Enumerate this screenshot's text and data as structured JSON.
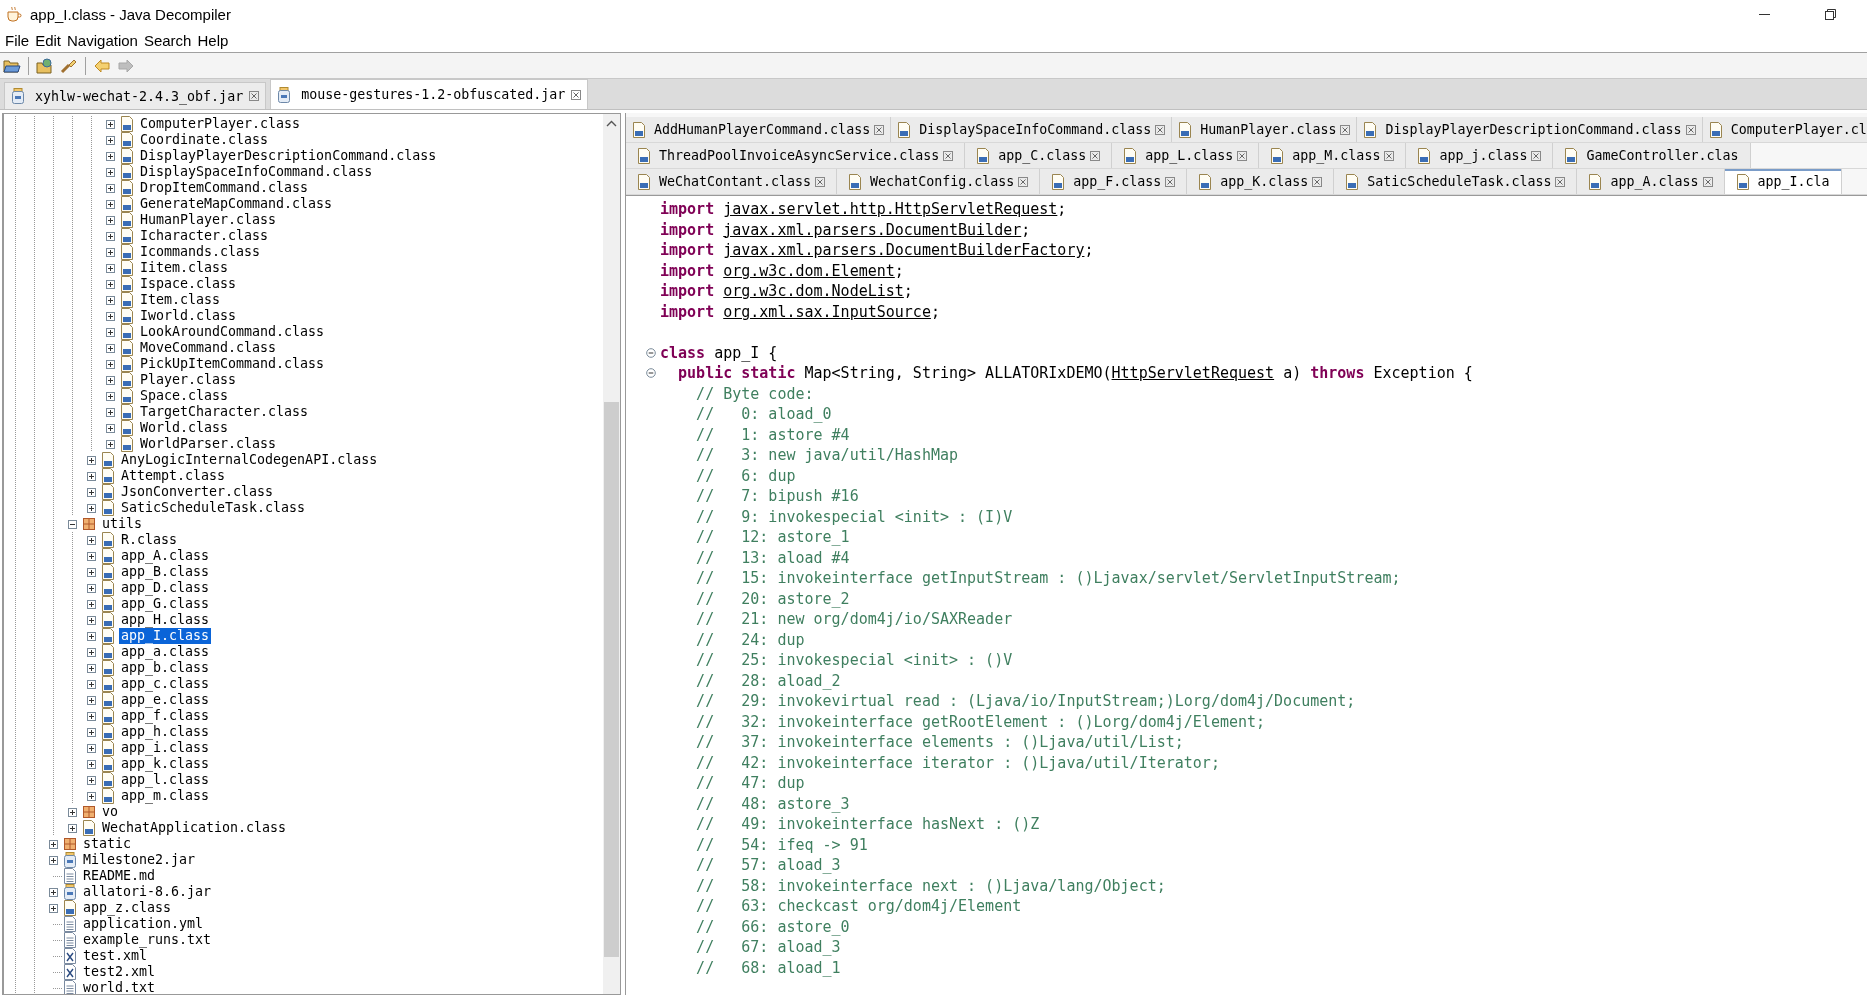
{
  "window": {
    "title": "app_I.class - Java Decompiler"
  },
  "menu": [
    "File",
    "Edit",
    "Navigation",
    "Search",
    "Help"
  ],
  "toolbar": [
    {
      "kind": "open-file",
      "disabled": false
    },
    {
      "kind": "open-type",
      "disabled": false
    },
    {
      "kind": "search",
      "disabled": false
    },
    {
      "kind": "back",
      "disabled": false
    },
    {
      "kind": "forward",
      "disabled": true
    }
  ],
  "file_tabs": [
    {
      "label": "xyhlw-wechat-2.4.3_obf.jar",
      "selected": false
    },
    {
      "label": "mouse-gestures-1.2-obfuscated.jar",
      "selected": true
    }
  ],
  "tree": {
    "items": [
      {
        "children": [
          {
            "children": [
              {
                "children": [
                  {
                    "children": [
                      {
                        "children": [
                          {
                            "label": "ComputerPlayer.class",
                            "kind": "class",
                            "expanded": false,
                            "selected": false
                          },
                          {
                            "label": "Coordinate.class",
                            "kind": "class",
                            "expanded": false,
                            "selected": false
                          },
                          {
                            "label": "DisplayPlayerDescriptionCommand.class",
                            "kind": "class",
                            "expanded": false,
                            "selected": false
                          },
                          {
                            "label": "DisplaySpaceInfoCommand.class",
                            "kind": "class",
                            "expanded": false,
                            "selected": false
                          },
                          {
                            "label": "DropItemCommand.class",
                            "kind": "class",
                            "expanded": false,
                            "selected": false
                          },
                          {
                            "label": "GenerateMapCommand.class",
                            "kind": "class",
                            "expanded": false,
                            "selected": false
                          },
                          {
                            "label": "HumanPlayer.class",
                            "kind": "class",
                            "expanded": false,
                            "selected": false
                          },
                          {
                            "label": "Icharacter.class",
                            "kind": "class",
                            "expanded": false,
                            "selected": false
                          },
                          {
                            "label": "Icommands.class",
                            "kind": "class",
                            "expanded": false,
                            "selected": false
                          },
                          {
                            "label": "Iitem.class",
                            "kind": "class",
                            "expanded": false,
                            "selected": false
                          },
                          {
                            "label": "Ispace.class",
                            "kind": "class",
                            "expanded": false,
                            "selected": false
                          },
                          {
                            "label": "Item.class",
                            "kind": "class",
                            "expanded": false,
                            "selected": false
                          },
                          {
                            "label": "Iworld.class",
                            "kind": "class",
                            "expanded": false,
                            "selected": false
                          },
                          {
                            "label": "LookAroundCommand.class",
                            "kind": "class",
                            "expanded": false,
                            "selected": false
                          },
                          {
                            "label": "MoveCommand.class",
                            "kind": "class",
                            "expanded": false,
                            "selected": false
                          },
                          {
                            "label": "PickUpItemCommand.class",
                            "kind": "class",
                            "expanded": false,
                            "selected": false
                          },
                          {
                            "label": "Player.class",
                            "kind": "class",
                            "expanded": false,
                            "selected": false
                          },
                          {
                            "label": "Space.class",
                            "kind": "class",
                            "expanded": false,
                            "selected": false
                          },
                          {
                            "label": "TargetCharacter.class",
                            "kind": "class",
                            "expanded": false,
                            "selected": false
                          },
                          {
                            "label": "World.class",
                            "kind": "class",
                            "expanded": false,
                            "selected": false
                          },
                          {
                            "label": "WorldParser.class",
                            "kind": "class",
                            "expanded": false,
                            "selected": false
                          }
                        ]
                      },
                      {
                        "label": "AnyLogicInternalCodegenAPI.class",
                        "kind": "class",
                        "expanded": false,
                        "selected": false
                      },
                      {
                        "label": "Attempt.class",
                        "kind": "class",
                        "expanded": false,
                        "selected": false
                      },
                      {
                        "label": "JsonConverter.class",
                        "kind": "class",
                        "expanded": false,
                        "selected": false
                      },
                      {
                        "label": "SaticScheduleTask.class",
                        "kind": "class",
                        "expanded": false,
                        "selected": false
                      }
                    ]
                  },
                  {
                    "label": "utils",
                    "kind": "package",
                    "expanded": true,
                    "selected": false,
                    "children": [
                      {
                        "label": "R.class",
                        "kind": "class",
                        "expanded": false,
                        "selected": false
                      },
                      {
                        "label": "app_A.class",
                        "kind": "class",
                        "expanded": false,
                        "selected": false
                      },
                      {
                        "label": "app_B.class",
                        "kind": "class",
                        "expanded": false,
                        "selected": false
                      },
                      {
                        "label": "app_D.class",
                        "kind": "class",
                        "expanded": false,
                        "selected": false
                      },
                      {
                        "label": "app_G.class",
                        "kind": "class",
                        "expanded": false,
                        "selected": false
                      },
                      {
                        "label": "app_H.class",
                        "kind": "class",
                        "expanded": false,
                        "selected": false
                      },
                      {
                        "label": "app_I.class",
                        "kind": "class",
                        "expanded": false,
                        "selected": true
                      },
                      {
                        "label": "app_a.class",
                        "kind": "class",
                        "expanded": false,
                        "selected": false
                      },
                      {
                        "label": "app_b.class",
                        "kind": "class",
                        "expanded": false,
                        "selected": false
                      },
                      {
                        "label": "app_c.class",
                        "kind": "class",
                        "expanded": false,
                        "selected": false
                      },
                      {
                        "label": "app_e.class",
                        "kind": "class",
                        "expanded": false,
                        "selected": false
                      },
                      {
                        "label": "app_f.class",
                        "kind": "class",
                        "expanded": false,
                        "selected": false
                      },
                      {
                        "label": "app_h.class",
                        "kind": "class",
                        "expanded": false,
                        "selected": false
                      },
                      {
                        "label": "app_i.class",
                        "kind": "class",
                        "expanded": false,
                        "selected": false
                      },
                      {
                        "label": "app_k.class",
                        "kind": "class",
                        "expanded": false,
                        "selected": false
                      },
                      {
                        "label": "app_l.class",
                        "kind": "class",
                        "expanded": false,
                        "selected": false
                      },
                      {
                        "label": "app_m.class",
                        "kind": "class",
                        "expanded": false,
                        "selected": false
                      }
                    ]
                  },
                  {
                    "label": "vo",
                    "kind": "package",
                    "expanded": false,
                    "selected": false
                  },
                  {
                    "label": "WechatApplication.class",
                    "kind": "class",
                    "expanded": false,
                    "selected": false
                  }
                ]
              },
              {
                "label": "static",
                "kind": "package",
                "expanded": false,
                "selected": false
              },
              {
                "label": "Milestone2.jar",
                "kind": "jar",
                "expanded": false,
                "selected": false
              },
              {
                "label": "README.md",
                "kind": "text",
                "selected": false
              },
              {
                "label": "allatori-8.6.jar",
                "kind": "jar",
                "expanded": false,
                "selected": false
              },
              {
                "label": "app_z.class",
                "kind": "class",
                "expanded": false,
                "selected": false
              },
              {
                "label": "application.yml",
                "kind": "text",
                "selected": false
              },
              {
                "label": "example_runs.txt",
                "kind": "text",
                "selected": false
              },
              {
                "label": "test.xml",
                "kind": "xml",
                "selected": false
              },
              {
                "label": "test2.xml",
                "kind": "xml",
                "selected": false
              },
              {
                "label": "world.txt",
                "kind": "text",
                "selected": false
              }
            ]
          }
        ]
      }
    ]
  },
  "editor_tab_rows": [
    {
      "tabs": [
        {
          "label": "AddHumanPlayerCommand.class",
          "selected": false
        },
        {
          "label": "DisplaySpaceInfoCommand.class",
          "selected": false
        },
        {
          "label": "HumanPlayer.class",
          "selected": false
        },
        {
          "label": "DisplayPlayerDescriptionCommand.class",
          "selected": false
        },
        {
          "label": "ComputerPlayer.cl",
          "selected": false
        }
      ]
    },
    {
      "tabs": [
        {
          "label": "ThreadPoolInvoiceAsyncService.class",
          "selected": false
        },
        {
          "label": "app_C.class",
          "selected": false
        },
        {
          "label": "app_L.class",
          "selected": false
        },
        {
          "label": "app_M.class",
          "selected": false
        },
        {
          "label": "app_j.class",
          "selected": false
        },
        {
          "label": "GameController.clas",
          "selected": false
        }
      ]
    },
    {
      "tabs": [
        {
          "label": "WeChatContant.class",
          "selected": false
        },
        {
          "label": "WechatConfig.class",
          "selected": false
        },
        {
          "label": "app_F.class",
          "selected": false
        },
        {
          "label": "app_K.class",
          "selected": false
        },
        {
          "label": "SaticScheduleTask.class",
          "selected": false
        },
        {
          "label": "app_A.class",
          "selected": false
        },
        {
          "label": "app_I.cla",
          "selected": true
        }
      ]
    }
  ],
  "code": {
    "lines": [
      {
        "collapsible": false,
        "segments": [
          {
            "kind": "keyword",
            "text": "import "
          },
          {
            "kind": "link",
            "text": "javax.servlet.http.HttpServletRequest"
          },
          {
            "kind": "plain",
            "text": ";"
          }
        ]
      },
      {
        "collapsible": false,
        "segments": [
          {
            "kind": "keyword",
            "text": "import "
          },
          {
            "kind": "link",
            "text": "javax.xml.parsers.DocumentBuilder"
          },
          {
            "kind": "plain",
            "text": ";"
          }
        ]
      },
      {
        "collapsible": false,
        "segments": [
          {
            "kind": "keyword",
            "text": "import "
          },
          {
            "kind": "link",
            "text": "javax.xml.parsers.DocumentBuilderFactory"
          },
          {
            "kind": "plain",
            "text": ";"
          }
        ]
      },
      {
        "collapsible": false,
        "segments": [
          {
            "kind": "keyword",
            "text": "import "
          },
          {
            "kind": "link",
            "text": "org.w3c.dom.Element"
          },
          {
            "kind": "plain",
            "text": ";"
          }
        ]
      },
      {
        "collapsible": false,
        "segments": [
          {
            "kind": "keyword",
            "text": "import "
          },
          {
            "kind": "link",
            "text": "org.w3c.dom.NodeList"
          },
          {
            "kind": "plain",
            "text": ";"
          }
        ]
      },
      {
        "collapsible": false,
        "segments": [
          {
            "kind": "keyword",
            "text": "import "
          },
          {
            "kind": "link",
            "text": "org.xml.sax.InputSource"
          },
          {
            "kind": "plain",
            "text": ";"
          }
        ]
      },
      {
        "collapsible": false
      },
      {
        "collapsible": true,
        "segments": [
          {
            "kind": "keyword",
            "text": "class "
          },
          {
            "kind": "plain",
            "text": "app_I {"
          }
        ]
      },
      {
        "collapsible": true,
        "segments": [
          {
            "kind": "keyword",
            "text": "  public static "
          },
          {
            "kind": "plain",
            "text": "Map<String, String> ALLATORIxDEMO("
          },
          {
            "kind": "link",
            "text": "HttpServletRequest"
          },
          {
            "kind": "plain",
            "text": " a) "
          },
          {
            "kind": "keyword",
            "text": "throws "
          },
          {
            "kind": "plain",
            "text": "Exception {"
          }
        ]
      },
      {
        "collapsible": false,
        "segments": [
          {
            "kind": "comment",
            "text": "    // Byte code:"
          }
        ]
      },
      {
        "collapsible": false,
        "segments": [
          {
            "kind": "comment",
            "text": "    //   0: aload_0"
          }
        ]
      },
      {
        "collapsible": false,
        "segments": [
          {
            "kind": "comment",
            "text": "    //   1: astore #4"
          }
        ]
      },
      {
        "collapsible": false,
        "segments": [
          {
            "kind": "comment",
            "text": "    //   3: new java/util/HashMap"
          }
        ]
      },
      {
        "collapsible": false,
        "segments": [
          {
            "kind": "comment",
            "text": "    //   6: dup"
          }
        ]
      },
      {
        "collapsible": false,
        "segments": [
          {
            "kind": "comment",
            "text": "    //   7: bipush #16"
          }
        ]
      },
      {
        "collapsible": false,
        "segments": [
          {
            "kind": "comment",
            "text": "    //   9: invokespecial <init> : (I)V"
          }
        ]
      },
      {
        "collapsible": false,
        "segments": [
          {
            "kind": "comment",
            "text": "    //   12: astore_1"
          }
        ]
      },
      {
        "collapsible": false,
        "segments": [
          {
            "kind": "comment",
            "text": "    //   13: aload #4"
          }
        ]
      },
      {
        "collapsible": false,
        "segments": [
          {
            "kind": "comment",
            "text": "    //   15: invokeinterface getInputStream : ()Ljavax/servlet/ServletInputStream;"
          }
        ]
      },
      {
        "collapsible": false,
        "segments": [
          {
            "kind": "comment",
            "text": "    //   20: astore_2"
          }
        ]
      },
      {
        "collapsible": false,
        "segments": [
          {
            "kind": "comment",
            "text": "    //   21: new org/dom4j/io/SAXReader"
          }
        ]
      },
      {
        "collapsible": false,
        "segments": [
          {
            "kind": "comment",
            "text": "    //   24: dup"
          }
        ]
      },
      {
        "collapsible": false,
        "segments": [
          {
            "kind": "comment",
            "text": "    //   25: invokespecial <init> : ()V"
          }
        ]
      },
      {
        "collapsible": false,
        "segments": [
          {
            "kind": "comment",
            "text": "    //   28: aload_2"
          }
        ]
      },
      {
        "collapsible": false,
        "segments": [
          {
            "kind": "comment",
            "text": "    //   29: invokevirtual read : (Ljava/io/InputStream;)Lorg/dom4j/Document;"
          }
        ]
      },
      {
        "collapsible": false,
        "segments": [
          {
            "kind": "comment",
            "text": "    //   32: invokeinterface getRootElement : ()Lorg/dom4j/Element;"
          }
        ]
      },
      {
        "collapsible": false,
        "segments": [
          {
            "kind": "comment",
            "text": "    //   37: invokeinterface elements : ()Ljava/util/List;"
          }
        ]
      },
      {
        "collapsible": false,
        "segments": [
          {
            "kind": "comment",
            "text": "    //   42: invokeinterface iterator : ()Ljava/util/Iterator;"
          }
        ]
      },
      {
        "collapsible": false,
        "segments": [
          {
            "kind": "comment",
            "text": "    //   47: dup"
          }
        ]
      },
      {
        "collapsible": false,
        "segments": [
          {
            "kind": "comment",
            "text": "    //   48: astore_3"
          }
        ]
      },
      {
        "collapsible": false,
        "segments": [
          {
            "kind": "comment",
            "text": "    //   49: invokeinterface hasNext : ()Z"
          }
        ]
      },
      {
        "collapsible": false,
        "segments": [
          {
            "kind": "comment",
            "text": "    //   54: ifeq -> 91"
          }
        ]
      },
      {
        "collapsible": false,
        "segments": [
          {
            "kind": "comment",
            "text": "    //   57: aload_3"
          }
        ]
      },
      {
        "collapsible": false,
        "segments": [
          {
            "kind": "comment",
            "text": "    //   58: invokeinterface next : ()Ljava/lang/Object;"
          }
        ]
      },
      {
        "collapsible": false,
        "segments": [
          {
            "kind": "comment",
            "text": "    //   63: checkcast org/dom4j/Element"
          }
        ]
      },
      {
        "collapsible": false,
        "segments": [
          {
            "kind": "comment",
            "text": "    //   66: astore_0"
          }
        ]
      },
      {
        "collapsible": false,
        "segments": [
          {
            "kind": "comment",
            "text": "    //   67: aload_3"
          }
        ]
      },
      {
        "collapsible": false,
        "segments": [
          {
            "kind": "comment",
            "text": "    //   68: aload_1"
          }
        ]
      }
    ]
  }
}
